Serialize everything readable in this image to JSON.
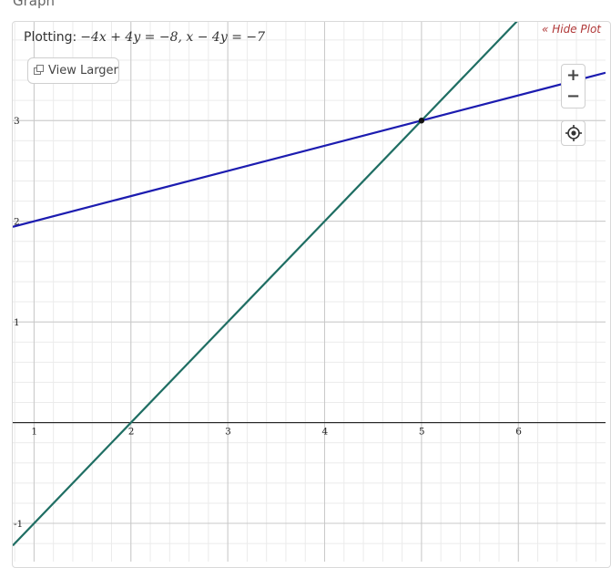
{
  "section_title": "Graph",
  "header": {
    "plotting_label": "Plotting:",
    "equations": "−4x + 4y = −8, x − 4y = −7",
    "hide_plot": "« Hide Plot"
  },
  "controls": {
    "view_larger": "View Larger",
    "zoom_in": "+",
    "zoom_out": "−"
  },
  "colors": {
    "line1": "#1c1cb0",
    "line2": "#1f6e63",
    "major_grid": "#c8c8c8",
    "minor_grid": "#ebebeb",
    "axis": "#222222"
  },
  "chart_data": {
    "type": "line",
    "xlim": [
      0.78,
      6.9
    ],
    "ylim": [
      -1.38,
      3.98
    ],
    "grid": true,
    "x_ticks": [
      "1",
      "2",
      "3",
      "4",
      "5",
      "6"
    ],
    "y_ticks": [
      "-1",
      "1",
      "2",
      "3"
    ],
    "series": [
      {
        "name": "-4x + 4y = -8",
        "x": [
          0.78,
          6.9
        ],
        "y": [
          -1.22,
          4.9
        ],
        "color": "#1f6e63"
      },
      {
        "name": "x - 4y = -7",
        "x": [
          0.78,
          6.9
        ],
        "y": [
          1.945,
          3.475
        ],
        "color": "#1c1cb0"
      }
    ],
    "intersection": {
      "x": 5,
      "y": 3
    }
  }
}
